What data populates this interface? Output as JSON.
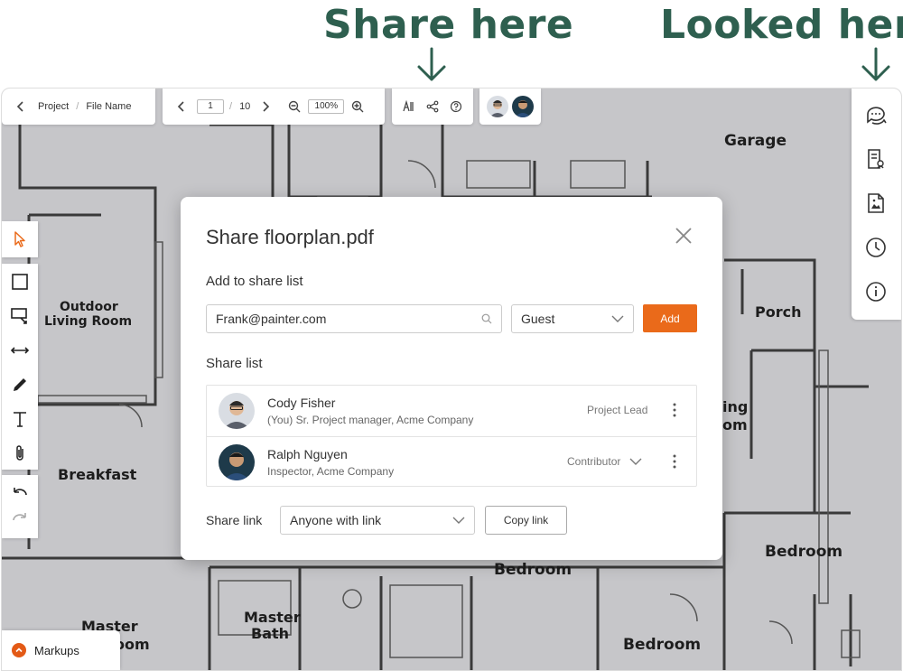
{
  "headlines": {
    "share": "Share here",
    "looked": "Looked here"
  },
  "colors": {
    "accent": "#ea6a1a",
    "headline": "#2e5f4f",
    "plan_background": "#c6c6c9"
  },
  "toolbar": {
    "breadcrumb": {
      "project": "Project",
      "separator": "/",
      "file": "File Name"
    },
    "page": {
      "current": "1",
      "total": "10"
    },
    "zoom": "100%"
  },
  "floorplan": {
    "rooms": [
      "Garage",
      "Outdoor",
      "Living Room",
      "Porch",
      "Breakfast",
      "ing",
      "om",
      "Bedroom",
      "Bedroom",
      "Master",
      "Bath",
      "Master",
      "oom",
      "Bedroom"
    ]
  },
  "sidebar": {
    "icons": [
      "comments-icon",
      "document-review-icon",
      "image-file-icon",
      "history-icon",
      "info-icon"
    ]
  },
  "tools": {
    "icons": [
      "cursor-icon",
      "rectangle-icon",
      "callout-icon",
      "measure-icon",
      "pencil-icon",
      "text-icon",
      "attach-icon",
      "undo-icon",
      "redo-icon"
    ]
  },
  "markups": {
    "label": "Markups"
  },
  "modal": {
    "title": "Share floorplan.pdf",
    "add_section": "Add to share list",
    "email_value": "Frank@painter.com",
    "role_value": "Guest",
    "add_button": "Add",
    "list_section": "Share list",
    "members": [
      {
        "name": "Cody Fisher",
        "subtitle": "(You) Sr. Project manager, Acme Company",
        "role": "Project Lead",
        "role_editable": false
      },
      {
        "name": "Ralph Nguyen",
        "subtitle": "Inspector, Acme Company",
        "role": "Contributor",
        "role_editable": true
      }
    ],
    "link_section": "Share link",
    "link_value": "Anyone with link",
    "copy_button": "Copy link"
  }
}
